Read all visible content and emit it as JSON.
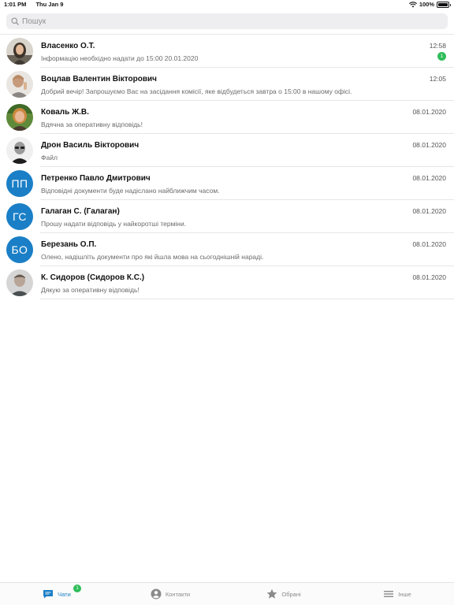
{
  "status_bar": {
    "time": "1:01 PM",
    "date": "Thu Jan 9",
    "battery": "100%"
  },
  "search": {
    "placeholder": "Пошук"
  },
  "chats": [
    {
      "name": "Власенко О.Т.",
      "preview": "Інформацію необхідно надати до 15:00 20.01.2020",
      "time": "12:58",
      "unread": "1",
      "avatar": "photo"
    },
    {
      "name": "Воцлав Валентин Вікторович",
      "preview": "Добрий вечір! Запрошуємо Вас на засідання комісії, яке відбудеться завтра о 15:00 в нашому офісі.",
      "time": "12:05",
      "avatar": "photo"
    },
    {
      "name": "Коваль Ж.В.",
      "preview": "Вдячна за оперативну відповідь!",
      "time": "08.01.2020",
      "avatar": "photo"
    },
    {
      "name": "Дрон Василь Вікторович",
      "preview": "Файл",
      "time": "08.01.2020",
      "avatar": "photo"
    },
    {
      "name": "Петренко Павло Дмитрович",
      "preview": "Відповідні документи буде надіслано найближчим часом.",
      "time": "08.01.2020",
      "initials": "ПП"
    },
    {
      "name": "Галаган С. (Галаган)",
      "preview": "Прошу надати відповідь у найкоротші терміни.",
      "time": "08.01.2020",
      "initials": "ГС"
    },
    {
      "name": "Березань О.П.",
      "preview": "Олено, надішліть документи про які йшла мова на сьогоднішній нараді.",
      "time": "08.01.2020",
      "initials": "БО"
    },
    {
      "name": "К. Сидоров (Сидоров К.С.)",
      "preview": "Дякую за оперативну відповідь!",
      "time": "08.01.2020",
      "avatar": "photo"
    }
  ],
  "tabs": [
    {
      "label": "Чати",
      "icon": "chat-icon",
      "badge": "1",
      "active": true
    },
    {
      "label": "Контакти",
      "icon": "person-icon"
    },
    {
      "label": "Обрані",
      "icon": "star-icon"
    },
    {
      "label": "Інше",
      "icon": "menu-icon"
    }
  ],
  "colors": {
    "accent": "#1a7fc6",
    "badge": "#2fbd5a",
    "avatar_initials_bg": "#1a7fc6"
  }
}
